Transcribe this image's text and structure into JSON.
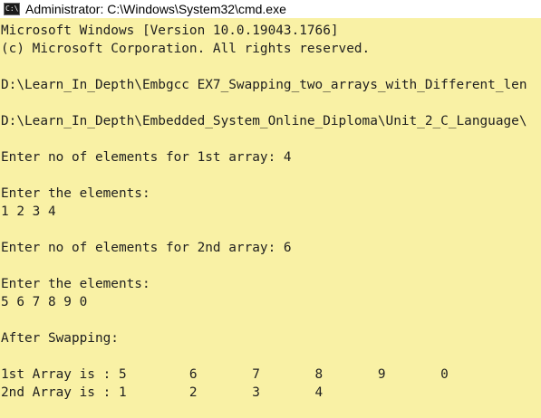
{
  "window": {
    "title": "Administrator: C:\\Windows\\System32\\cmd.exe",
    "icon_glyph": "C:\\",
    "icon_name": "cmd-icon",
    "background_color": "#f9f1a5",
    "text_color": "#1f1f1f"
  },
  "console": {
    "lines": [
      "Microsoft Windows [Version 10.0.19043.1766]",
      "(c) Microsoft Corporation. All rights reserved.",
      "",
      "D:\\Learn_In_Depth\\Embgcc EX7_Swapping_two_arrays_with_Different_len",
      "",
      "D:\\Learn_In_Depth\\Embedded_System_Online_Diploma\\Unit_2_C_Language\\",
      "",
      "Enter no of elements for 1st array: 4",
      "",
      "Enter the elements:",
      "1 2 3 4",
      "",
      "Enter no of elements for 2nd array: 6",
      "",
      "Enter the elements:",
      "5 6 7 8 9 0",
      "",
      "After Swapping:",
      "",
      "1st Array is : 5        6       7       8       9       0",
      "2nd Array is : 1        2       3       4"
    ]
  }
}
